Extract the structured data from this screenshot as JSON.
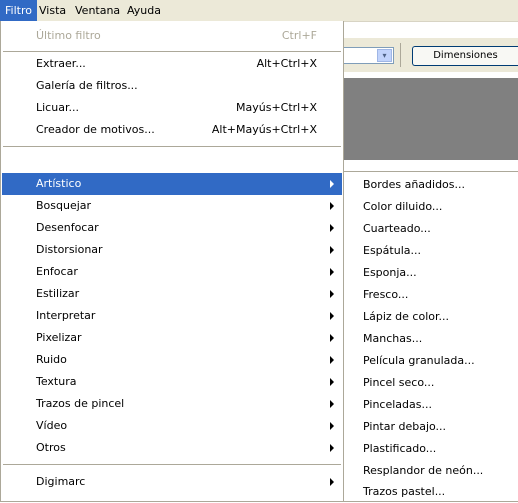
{
  "menubar": {
    "items": [
      "Filtro",
      "Vista",
      "Ventana",
      "Ayuda"
    ]
  },
  "toolbar": {
    "dimensions_button": "Dimensiones",
    "combo_arrow": "▾"
  },
  "filter_menu": {
    "last_filter": {
      "label": "Último filtro",
      "shortcut": "Ctrl+F"
    },
    "group1": [
      {
        "label": "Extraer...",
        "shortcut": "Alt+Ctrl+X"
      },
      {
        "label": "Galería de filtros...",
        "shortcut": ""
      },
      {
        "label": "Licuar...",
        "shortcut": "Mayús+Ctrl+X"
      },
      {
        "label": "Creador de motivos...",
        "shortcut": "Alt+Mayús+Ctrl+X"
      }
    ],
    "submenus": [
      "Artístico",
      "Bosquejar",
      "Desenfocar",
      "Distorsionar",
      "Enfocar",
      "Estilizar",
      "Interpretar",
      "Pixelizar",
      "Ruido",
      "Textura",
      "Trazos de pincel",
      "Vídeo",
      "Otros"
    ],
    "plugins": [
      "Digimarc"
    ]
  },
  "artistic_submenu": {
    "items": [
      "Bordes añadidos...",
      "Color diluido...",
      "Cuarteado...",
      "Espátula...",
      "Esponja...",
      "Fresco...",
      "Lápiz de color...",
      "Manchas...",
      "Película granulada...",
      "Pincel seco...",
      "Pinceladas...",
      "Pintar debajo...",
      "Plastificado...",
      "Resplandor de neón...",
      "Trazos pastel..."
    ]
  },
  "colors": {
    "highlight": "#316ac5",
    "menubar_bg": "#ece9d8",
    "disabled_text": "#aca899",
    "canvas": "#808080"
  }
}
